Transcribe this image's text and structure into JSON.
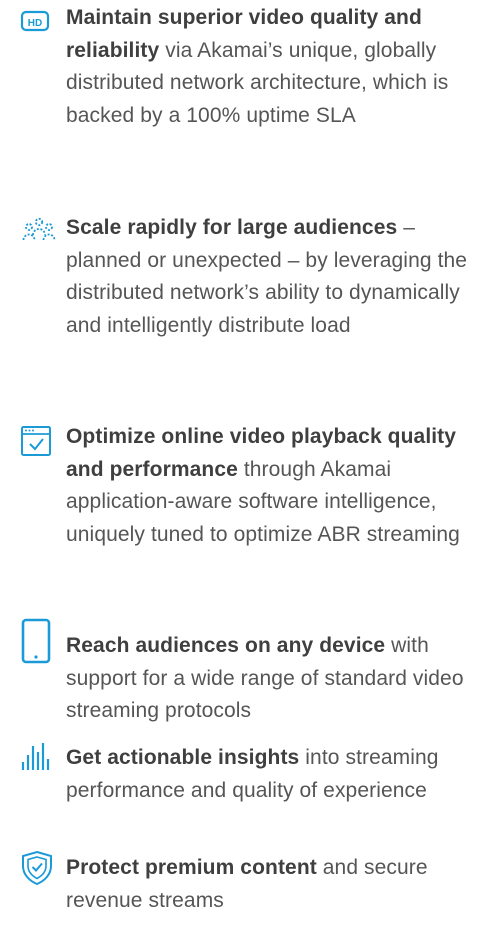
{
  "accent": "#1a9bd7",
  "items": [
    {
      "icon": "hd-icon",
      "lead": "Maintain superior video quality and reliability",
      "rest": " via Akamai’s unique, globally distributed network architecture, which is backed by a 100% uptime SLA"
    },
    {
      "icon": "audience-icon",
      "lead": "Scale rapidly for large audiences",
      "rest": " – planned or unexpected – by leveraging the distributed network’s ability to dynamically and intelligently distribute load"
    },
    {
      "icon": "browser-check-icon",
      "lead": "Optimize online video playback quality and performance",
      "rest": " through Akamai application-aware software intelligence, uniquely tuned to optimize ABR streaming"
    },
    {
      "icon": "mobile-device-icon",
      "lead": "Reach audiences on any device",
      "rest": " with support for a wide range of standard video streaming protocols"
    },
    {
      "icon": "bar-chart-icon",
      "lead": "Get actionable insights",
      "rest": " into streaming performance and quality of experience"
    },
    {
      "icon": "shield-check-icon",
      "lead": "Protect premium content",
      "rest": " and secure revenue streams"
    }
  ]
}
